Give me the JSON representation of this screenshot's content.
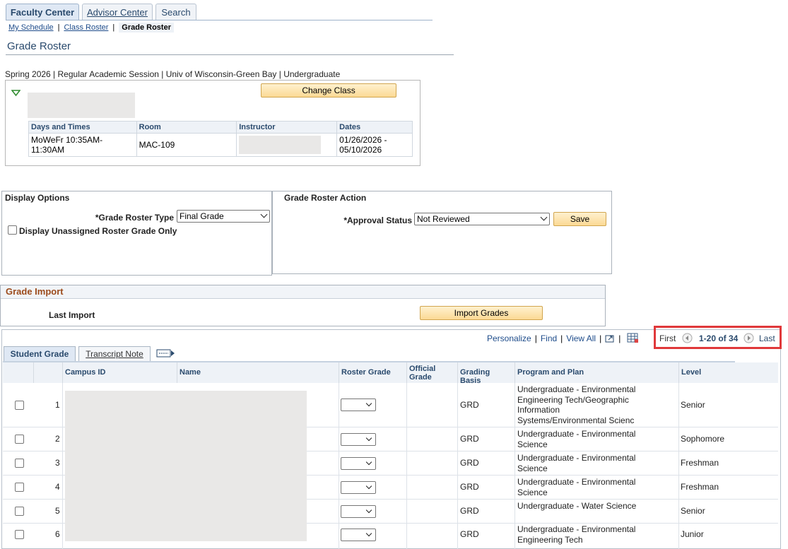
{
  "top_tabs": [
    "Faculty Center",
    "Advisor Center",
    "Search"
  ],
  "subnav": {
    "items": [
      "My Schedule",
      "Class Roster",
      "Grade Roster"
    ],
    "separator": "|"
  },
  "page_title": "Grade Roster",
  "term_info": "Spring 2026 | Regular Academic Session | Univ of Wisconsin-Green Bay | Undergraduate",
  "class_section": {
    "change_class_label": "Change Class",
    "table": {
      "headers": [
        "Days and Times",
        "Room",
        "Instructor",
        "Dates"
      ],
      "row": {
        "days_times": "MoWeFr 10:35AM-11:30AM",
        "room": "MAC-109",
        "dates": "01/26/2026 - 05/10/2026"
      }
    }
  },
  "display_options": {
    "title": "Display Options",
    "roster_type_label": "*Grade Roster Type",
    "roster_type_value": "Final Grade",
    "unassigned_label": "Display Unassigned Roster Grade Only"
  },
  "grade_roster_action": {
    "title": "Grade Roster Action",
    "approval_label": "*Approval Status",
    "approval_value": "Not Reviewed",
    "save_label": "Save"
  },
  "grade_import": {
    "title": "Grade Import",
    "last_import_label": "Last Import",
    "import_button": "Import Grades"
  },
  "grid_toolbar": {
    "personalize": "Personalize",
    "find": "Find",
    "view_all": "View All",
    "first": "First",
    "range": "1-20 of 34",
    "last": "Last",
    "sep": "|"
  },
  "grid_tabs": [
    "Student Grade",
    "Transcript Note"
  ],
  "columns": {
    "campus_id": "Campus ID",
    "name": "Name",
    "roster_grade": "Roster Grade",
    "official_grade": "Official Grade",
    "grading_basis": "Grading Basis",
    "program_plan": "Program and Plan",
    "level": "Level"
  },
  "students": [
    {
      "num": "1",
      "grading_basis": "GRD",
      "program": "Undergraduate - Environmental Engineering Tech/Geographic Information Systems/Environmental Scienc",
      "level": "Senior"
    },
    {
      "num": "2",
      "grading_basis": "GRD",
      "program": "Undergraduate - Environmental Science",
      "level": "Sophomore"
    },
    {
      "num": "3",
      "grading_basis": "GRD",
      "program": "Undergraduate - Environmental Science",
      "level": "Freshman"
    },
    {
      "num": "4",
      "grading_basis": "GRD",
      "program": "Undergraduate - Environmental Science",
      "level": "Freshman"
    },
    {
      "num": "5",
      "grading_basis": "GRD",
      "program": "Undergraduate - Water Science",
      "level": "Senior"
    },
    {
      "num": "6",
      "grading_basis": "GRD",
      "program": "Undergraduate - Environmental Engineering Tech",
      "level": "Junior"
    }
  ],
  "colors": {
    "highlight": "#e0383a",
    "accent": "#2a4a6d",
    "button": "#fbd994",
    "import_title": "#9c4b1c"
  }
}
